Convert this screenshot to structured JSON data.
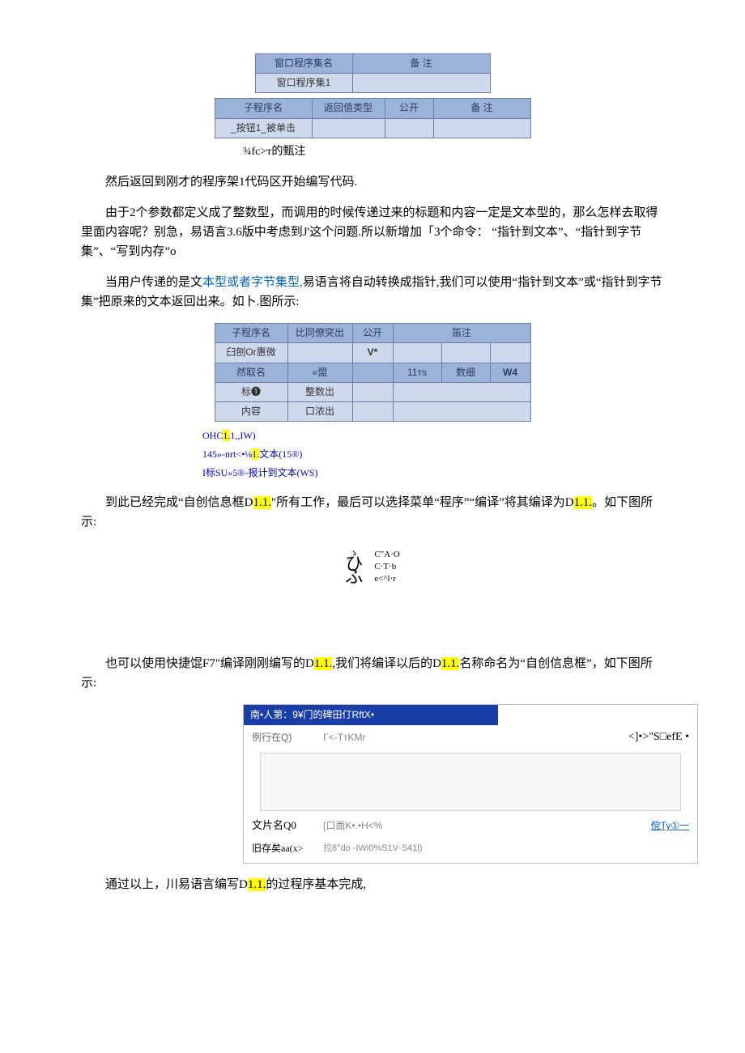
{
  "table1": {
    "top_headers": [
      "窗口程序集名",
      "备 注"
    ],
    "top_row": [
      "窗口程序集1",
      ""
    ],
    "sub_headers": [
      "子程序名",
      "返回值类型",
      "公开",
      "备 注"
    ],
    "sub_row": [
      "_按钮1_被单击",
      "",
      "",
      ""
    ]
  },
  "caption1": "¾fc>т的甄注",
  "para1": "然后返回到刚才的程序架1代码区开始编写代码.",
  "para2_a": "由于2个参数都定义成了整数型，而调用的时候传递过来的标题和内容一定是文本型的，那么怎样去取得里面内容呢？别急，易语言3.6版中考虑到J'这个问题.所以新增加「3个命令：",
  "para2_b": "“指针到文本”、“指针到字节集”、“写到内存”o",
  "para3_a": "当用户传递的是文",
  "para3_link": "本型或者字节集型,",
  "para3_b": "易语言将自动转换成指针,我们可以使用“指针到文本”或“指针到字节集”把原来的文本返回出来。如卜.图所示:",
  "table2": {
    "headers": [
      "子程序名",
      "比同僚突出",
      "公开",
      "笛注_a",
      "笛注_b",
      "笛注_c"
    ],
    "merged_header_right": "笛注",
    "row1": [
      "臼刨Or惠微",
      "",
      "V*",
      "",
      "",
      ""
    ],
    "row2": [
      "然取名",
      "«盟",
      "",
      "11тs",
      "数细",
      "W4"
    ],
    "row3": [
      "标❶",
      "整数岀",
      "",
      "",
      "",
      ""
    ],
    "row4": [
      "内容",
      "口浓出",
      "",
      "",
      "",
      ""
    ]
  },
  "code_lines": {
    "l1a": "OHC",
    "l1b": "1.",
    "l1c": "1,,IW)",
    "l2a": "145»-nrt<•⅛",
    "l2b": "1.",
    "l2c": "文本(15®)",
    "l3": "I标SU»5®-报计到文本(WS)"
  },
  "para4_a": "到此已经完成“自创信息框D",
  "para4_b": "1.1.",
  "para4_c": "\"所有工作，最后可以选择菜单“程序”“编译”将其编译为D",
  "para4_d": "1.1.",
  "para4_e": "。如下图所示:",
  "glyph": {
    "curls": [
      "ゝ",
      "ひ",
      "ふ"
    ],
    "lines": [
      "C\"A·O",
      "C·T·b",
      "e<^l·r"
    ]
  },
  "para5_a": "也可以使用快捷馄F7\"编译刚刚编写的D",
  "para5_b": "1.1.",
  "para5_c": ",我们将编译以后的D",
  "para5_d": "1.1.",
  "para5_e": "名称命名为“自创信息框”，如下图所示:",
  "dialog": {
    "title": "南•人第：9¥门的碑田仃RftX•",
    "look_in_label": "例行在Q)",
    "look_in_value": "Γ<-TтKMr",
    "right_note": "<]•>\"S□efE •",
    "filename_label": "文片名Q0",
    "filename_value": "[口面K•.•H<%",
    "filename_link": "傥Ty①一",
    "type_label": "旧存矣aa(x>",
    "type_value": "拉8°do -IWi0%S1V·S41l)"
  },
  "para6_a": "通过以上，川易语言编写D",
  "para6_b": "1.1.",
  "para6_c": "的过程序基本完成,"
}
